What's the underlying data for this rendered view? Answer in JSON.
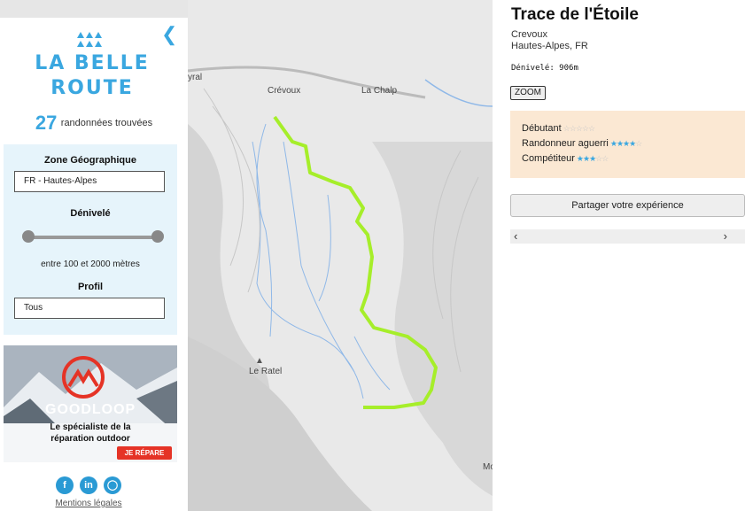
{
  "map": {
    "places": [
      "yral",
      "Crévoux",
      "La Chalp",
      "Le Ratel",
      "Mo"
    ]
  },
  "sidebar": {
    "logo": [
      "LA BELLE",
      "ROUTE"
    ],
    "collapse_icon": "chevron-left-icon",
    "results_count": "27",
    "results_label": "randonnées trouvées",
    "filters": {
      "zone_label": "Zone Géographique",
      "zone_value": "FR - Hautes-Alpes",
      "denivele_label": "Dénivelé",
      "range_min": 100,
      "range_max": 2000,
      "range_text": "entre 100 et 2000 mètres",
      "profil_label": "Profil",
      "profil_value": "Tous"
    },
    "ad": {
      "brand": "GOODLOOP",
      "line1": "Le spécialiste de la",
      "line2": "réparation outdoor",
      "button": "JE RÉPARE"
    },
    "socials": [
      "facebook-icon",
      "linkedin-icon",
      "instagram-icon"
    ],
    "legal": "Mentions légales"
  },
  "panel": {
    "title": "Trace de l'Étoile",
    "city": "Crevoux",
    "region": "Hautes-Alpes, FR",
    "denivele": "Dénivelé: 906m",
    "zoom": "ZOOM",
    "levels": [
      {
        "label": "Débutant",
        "rating": 0,
        "max": 5
      },
      {
        "label": "Randonneur aguerri",
        "rating": 4,
        "max": 5
      },
      {
        "label": "Compétiteur",
        "rating": 3,
        "max": 5
      }
    ],
    "share": "Partager votre expérience",
    "colors": {
      "accent": "#3aa7e0",
      "levels_bg": "#fbe8d3",
      "trace": "#a6ee2a"
    }
  }
}
